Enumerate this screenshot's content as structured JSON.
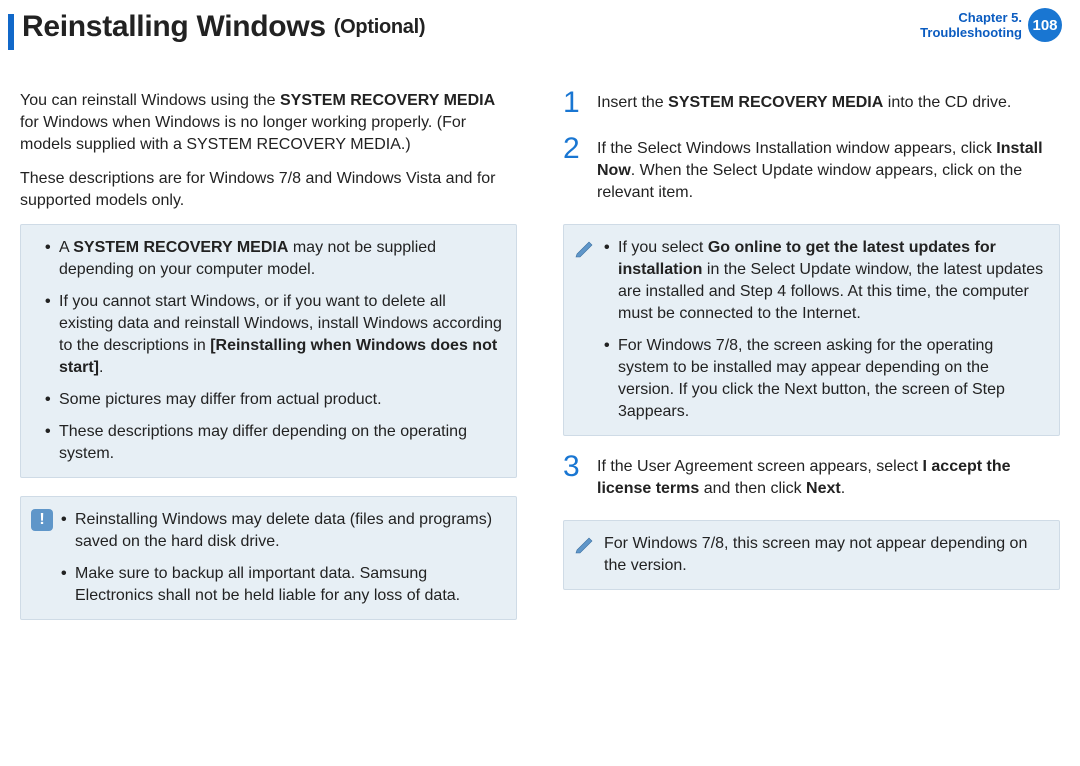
{
  "header": {
    "title": "Reinstalling Windows",
    "subtitle": "(Optional)",
    "chapter_line1": "Chapter 5.",
    "chapter_line2": "Troubleshooting",
    "page_number": "108"
  },
  "left": {
    "intro_p1_a": "You can reinstall Windows using the ",
    "intro_p1_b": "SYSTEM RECOVERY MEDIA",
    "intro_p1_c": " for Windows when Windows is no longer working properly. (For models supplied with a SYSTEM RECOVERY MEDIA.)",
    "intro_p2": "These descriptions are for Windows 7/8 and Windows Vista and for supported models only.",
    "box1": {
      "i1_a": "A ",
      "i1_b": "SYSTEM RECOVERY MEDIA",
      "i1_c": " may not be supplied depending on your computer model.",
      "i2_a": "If you cannot start Windows, or if you want to delete all existing data and reinstall Windows, install Windows according to the descriptions in ",
      "i2_b": "[Reinstalling when Windows does not start]",
      "i2_c": ".",
      "i3": "Some pictures may differ from actual product.",
      "i4": "These descriptions may differ depending on the operating system."
    },
    "box2": {
      "i1": "Reinstalling Windows may delete data (files and programs) saved on the hard disk drive.",
      "i2": "Make sure to backup all important data. Samsung Electronics shall not be held liable for any loss of data."
    }
  },
  "right": {
    "step1": {
      "num": "1",
      "a": "Insert the ",
      "b": "SYSTEM RECOVERY MEDIA",
      "c": " into the CD drive."
    },
    "step2": {
      "num": "2",
      "a": "If the Select Windows Installation window appears, click ",
      "b": "Install Now",
      "c": ". When the Select Update window appears, click on the relevant item."
    },
    "note1": {
      "i1_a": "If you select ",
      "i1_b": "Go online to get the latest updates for installation",
      "i1_c": " in the Select Update window, the latest updates are installed and Step 4 follows. At this time, the computer must be connected to the Internet.",
      "i2": "For Windows 7/8, the screen asking for the operating system to be installed may appear depending on the version. If you click the Next button, the screen of Step 3appears."
    },
    "step3": {
      "num": "3",
      "a": "If the User Agreement screen appears, select ",
      "b": "I accept the license terms",
      "c": " and then click ",
      "d": "Next",
      "e": "."
    },
    "note2": {
      "text": "For Windows 7/8, this screen may not appear depending on the version."
    }
  }
}
